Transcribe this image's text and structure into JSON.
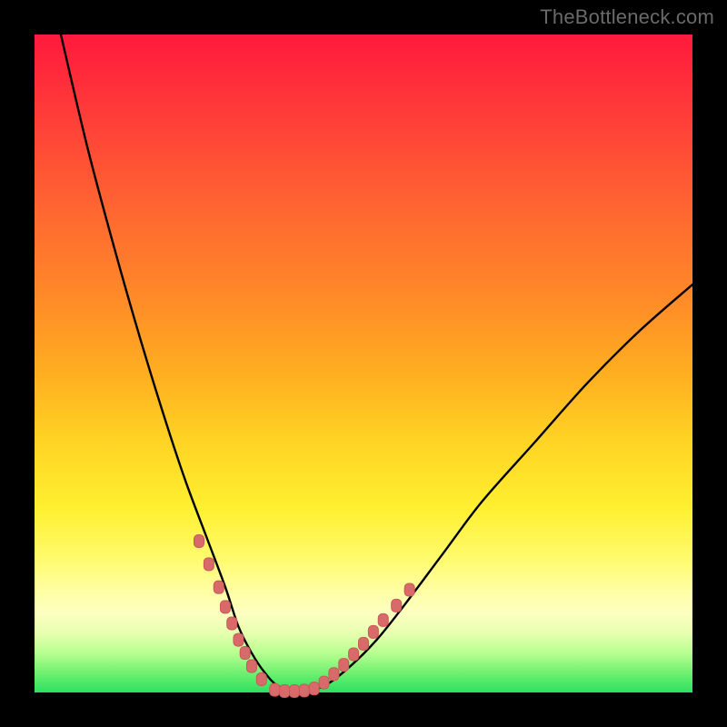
{
  "watermark": "TheBottleneck.com",
  "colors": {
    "background": "#000000",
    "curve_stroke": "#000000",
    "marker_fill": "#d86a6a",
    "marker_stroke": "#c85858"
  },
  "chart_data": {
    "type": "line",
    "title": "",
    "xlabel": "",
    "ylabel": "",
    "xlim": [
      0,
      100
    ],
    "ylim": [
      0,
      100
    ],
    "grid": false,
    "legend": false,
    "note": "Values estimated from pixel positions; x and y in percent of plot area (0=left/bottom, 100=right/top).",
    "series": [
      {
        "name": "bottleneck-curve",
        "x": [
          4,
          8,
          12,
          16,
          20,
          23,
          26,
          29,
          31,
          33,
          35,
          37,
          40,
          44,
          48,
          52,
          56,
          62,
          68,
          76,
          84,
          92,
          100
        ],
        "y": [
          100,
          83,
          68,
          54,
          41,
          32,
          24,
          16,
          10,
          6,
          3,
          1,
          0,
          1,
          4,
          8,
          13,
          21,
          29,
          38,
          47,
          55,
          62
        ]
      }
    ],
    "markers": [
      {
        "name": "highlight-left-branch",
        "x": [
          25.0,
          26.5,
          28.0,
          29.0,
          30.0,
          31.0,
          32.0,
          33.0,
          34.5
        ],
        "y": [
          23.0,
          19.5,
          16.0,
          13.0,
          10.5,
          8.0,
          6.0,
          4.0,
          2.0
        ]
      },
      {
        "name": "curve-minimum",
        "x": [
          36.5,
          38.0,
          39.5,
          41.0,
          42.5
        ],
        "y": [
          0.4,
          0.2,
          0.2,
          0.3,
          0.6
        ]
      },
      {
        "name": "highlight-right-branch",
        "x": [
          44.0,
          45.5,
          47.0,
          48.5,
          50.0,
          51.5,
          53.0,
          55.0,
          57.0
        ],
        "y": [
          1.5,
          2.8,
          4.2,
          5.8,
          7.4,
          9.2,
          11.0,
          13.2,
          15.6
        ]
      }
    ]
  }
}
